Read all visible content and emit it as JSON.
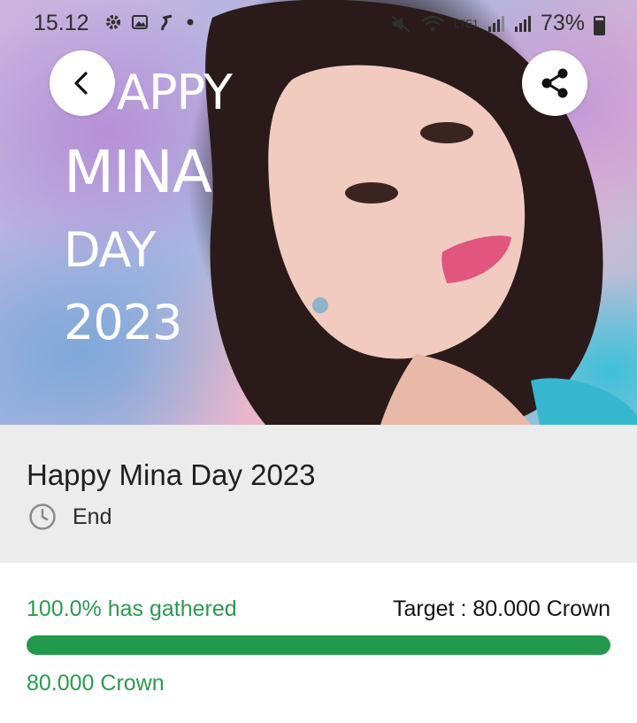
{
  "status_bar": {
    "time": "15.12",
    "battery": "73%",
    "network": "LTE1",
    "left_icons": [
      "gear-icon",
      "image-icon",
      "app-notification-icon",
      "dot-icon"
    ],
    "right_icons": [
      "mute-icon",
      "wifi-icon",
      "volte-icon",
      "signal-icon",
      "signal-icon",
      "battery-icon"
    ]
  },
  "hero": {
    "poster_lines": [
      "APPY",
      "MINA",
      "DAY",
      "2023"
    ],
    "back_icon": "chevron-left-icon",
    "share_icon": "share-icon"
  },
  "event": {
    "title": "Happy Mina Day 2023",
    "status": "End",
    "status_icon": "clock-icon"
  },
  "progress": {
    "gathered_text": "100.0% has gathered",
    "target_text": "Target : 80.000 Crown",
    "fraction": 1.0,
    "amount_text": "80.000 Crown",
    "fill_color": "#22994d",
    "accent_text_color": "#2a9a4f"
  }
}
